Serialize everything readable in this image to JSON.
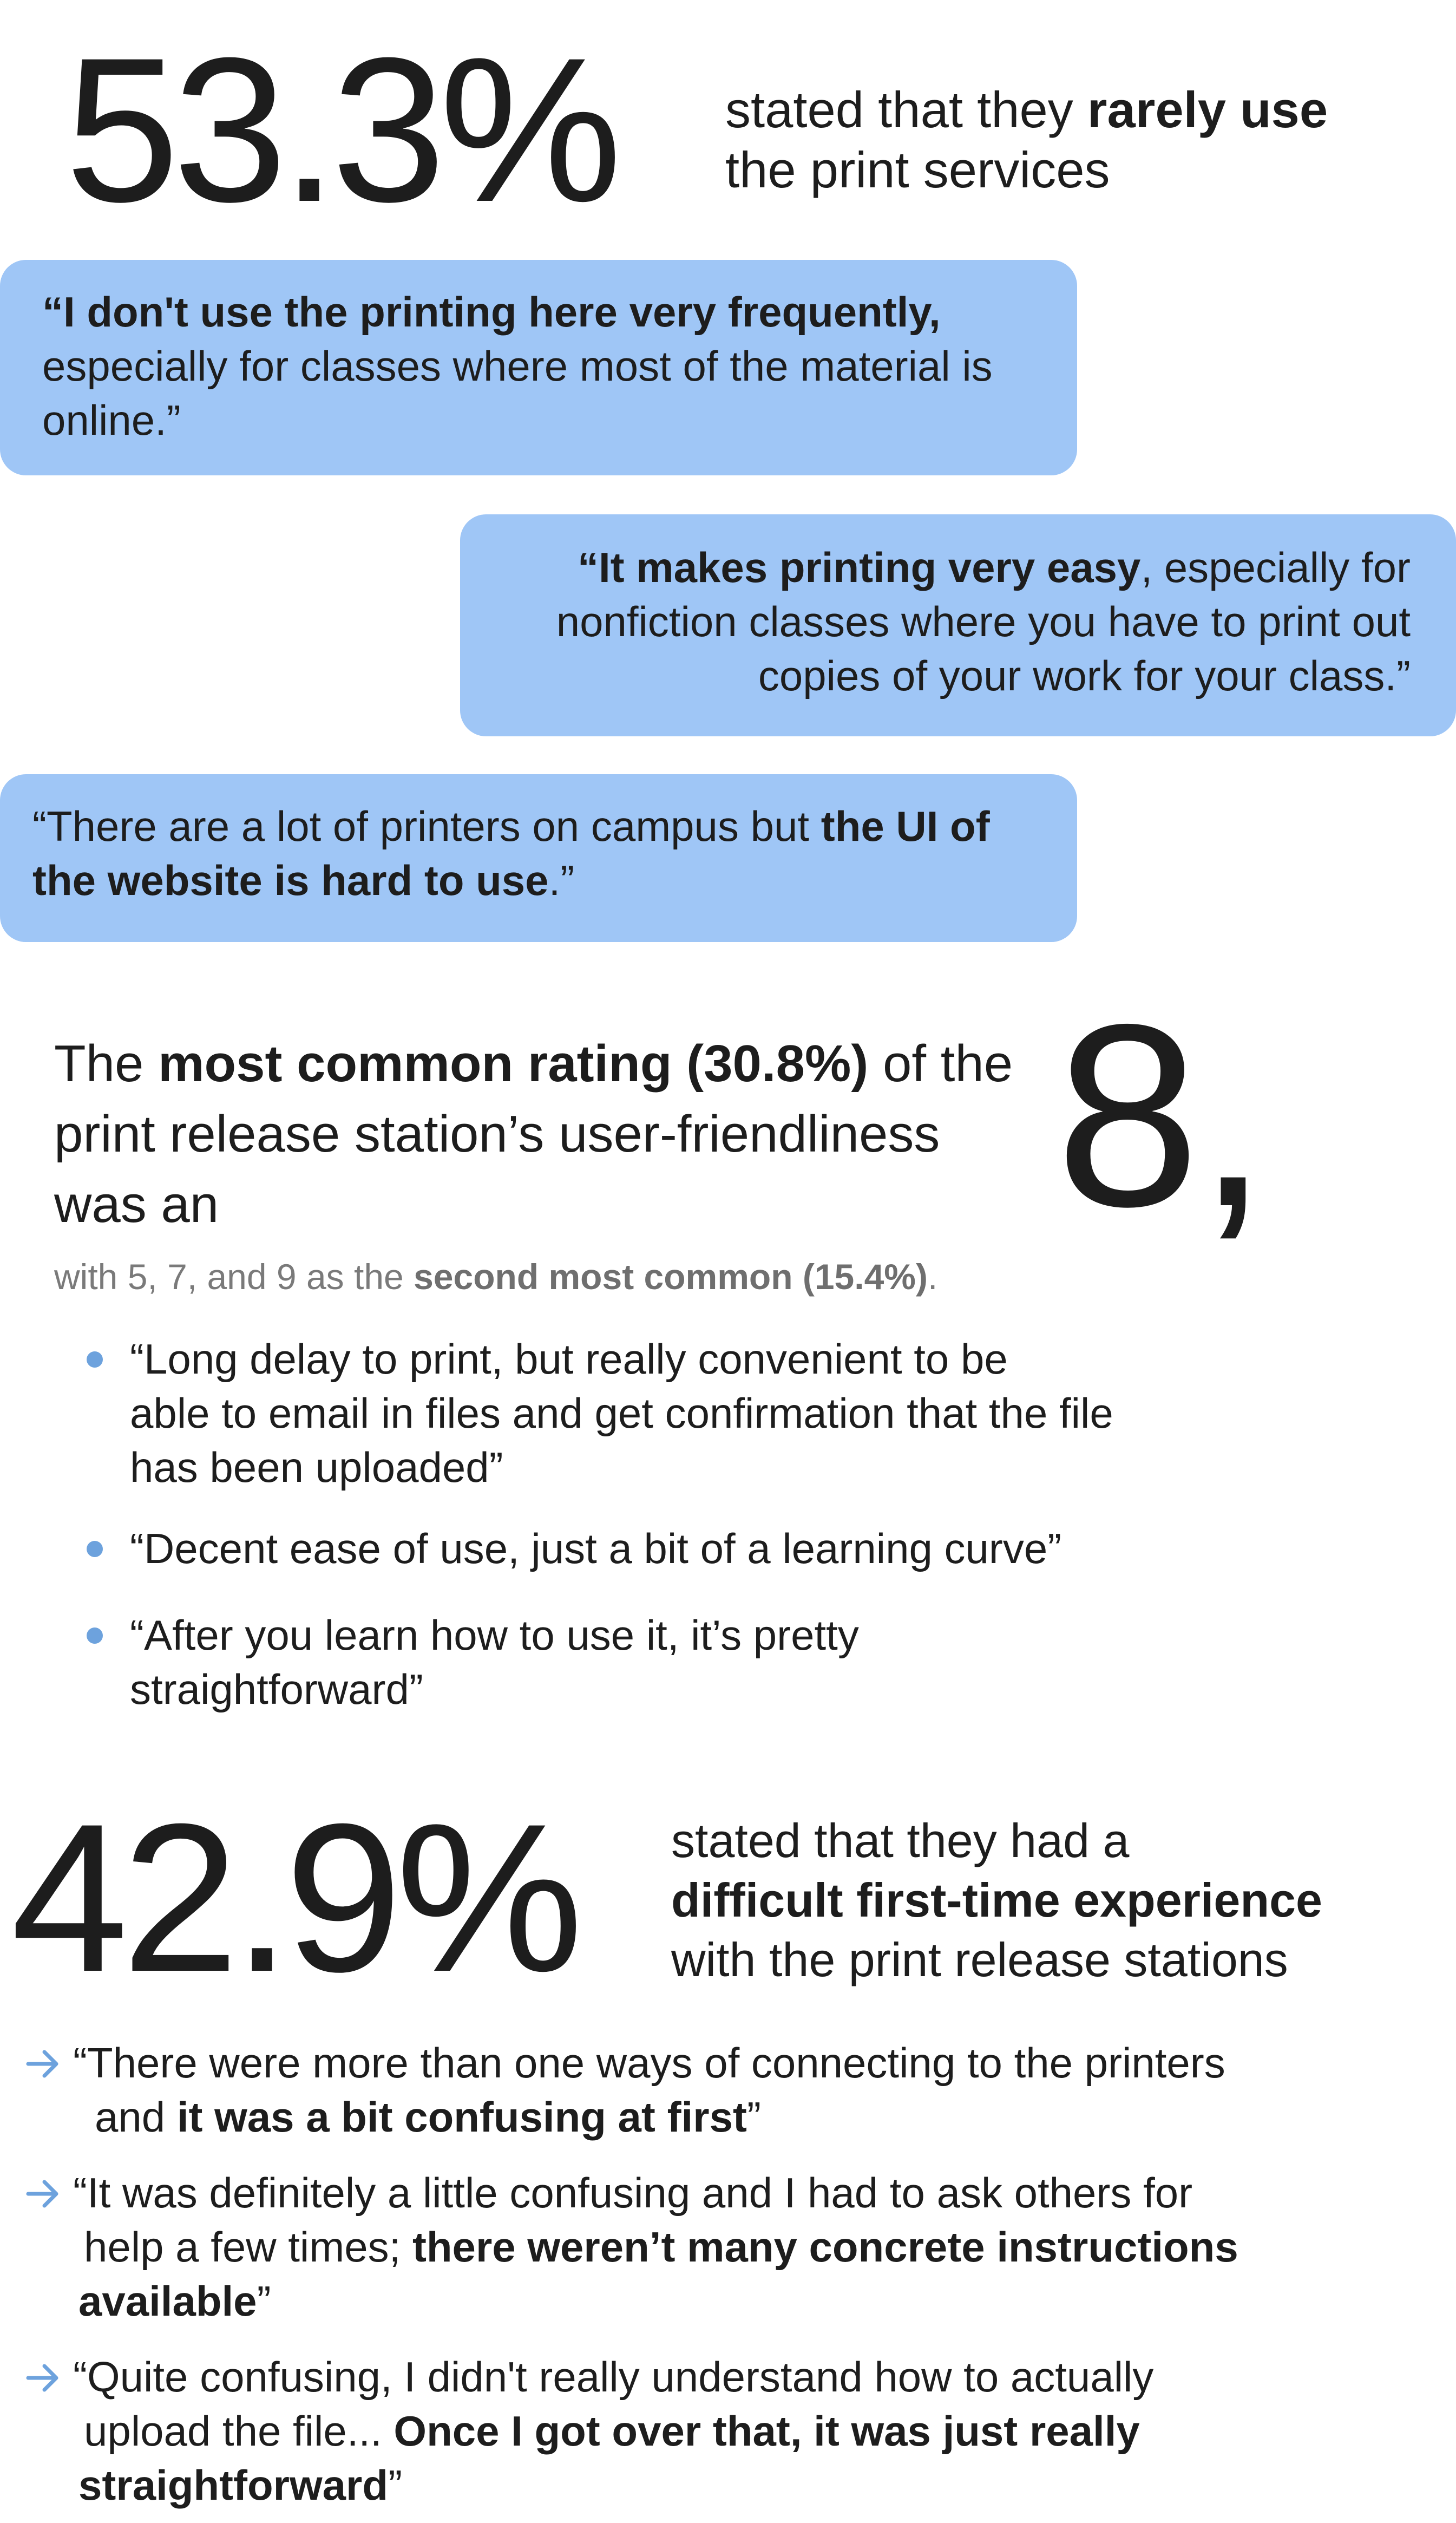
{
  "stat1": {
    "value": "53.3%",
    "caption_pre": "stated that they ",
    "caption_bold": "rarely use",
    "caption_post": "the print services"
  },
  "quotes": [
    {
      "bold": "“I don't use the printing here very frequently,",
      "rest": "especially for classes where most of the material is",
      "rest2": "online.”"
    },
    {
      "bold": "“It makes printing very easy",
      "rest": ", especially for",
      "line2": "nonfiction classes where you have to print out",
      "line3": "copies of your work for your class.”"
    },
    {
      "pre": "“There are a lot of printers on campus but ",
      "bold1": "the UI of",
      "bold2": "the website is hard to use",
      "post": ".”"
    }
  ],
  "rating": {
    "pre": "The ",
    "bold": "most common rating (30.8%)",
    "post": " of the",
    "line2": "print release station’s user-friendliness",
    "line3": "was an",
    "big_value": "8,",
    "sub_pre": "with 5, 7, and 9 as the ",
    "sub_bold": "second most common (15.4%)",
    "sub_post": "."
  },
  "bullets": [
    {
      "line1": "“Long delay to print, but really convenient to be",
      "line2": "able to email in files and get confirmation that the file",
      "line3": "has been uploaded”"
    },
    {
      "line1": "“Decent ease of use, just a bit of a learning curve”"
    },
    {
      "line1": "“After you learn how to use it, it’s pretty",
      "line2": "straightforward”"
    }
  ],
  "stat2": {
    "value": "42.9%",
    "caption1": "stated that they had a",
    "caption_bold": "difficult first-time experience",
    "caption3": "with the print release stations"
  },
  "arrow_quotes": [
    {
      "line1": "“There were more than one ways of connecting to the printers",
      "line2_pre": "and ",
      "line2_bold": "it was a bit confusing at first",
      "line2_post": "”"
    },
    {
      "line1": "“It was definitely a little confusing and I had to ask others for",
      "line2_pre": "help a few times; ",
      "line2_bold": "there weren’t many concrete instructions",
      "line3_bold": "available",
      "line3_post": "”"
    },
    {
      "line1": "“Quite confusing, I didn't really understand how to actually",
      "line2_pre": "upload the file... ",
      "line2_bold": "Once I got over that, it was just really",
      "line3_bold": "straightforward",
      "line3_post": "”"
    }
  ],
  "colors": {
    "bubble": "#9fc6f6",
    "bullet_dot": "#6da2dd",
    "arrow": "#6da2dd",
    "text": "#1d1d1d",
    "muted": "#7a7a7a"
  },
  "icons": {
    "bullet": "dot-icon",
    "arrow": "arrow-right-icon"
  }
}
